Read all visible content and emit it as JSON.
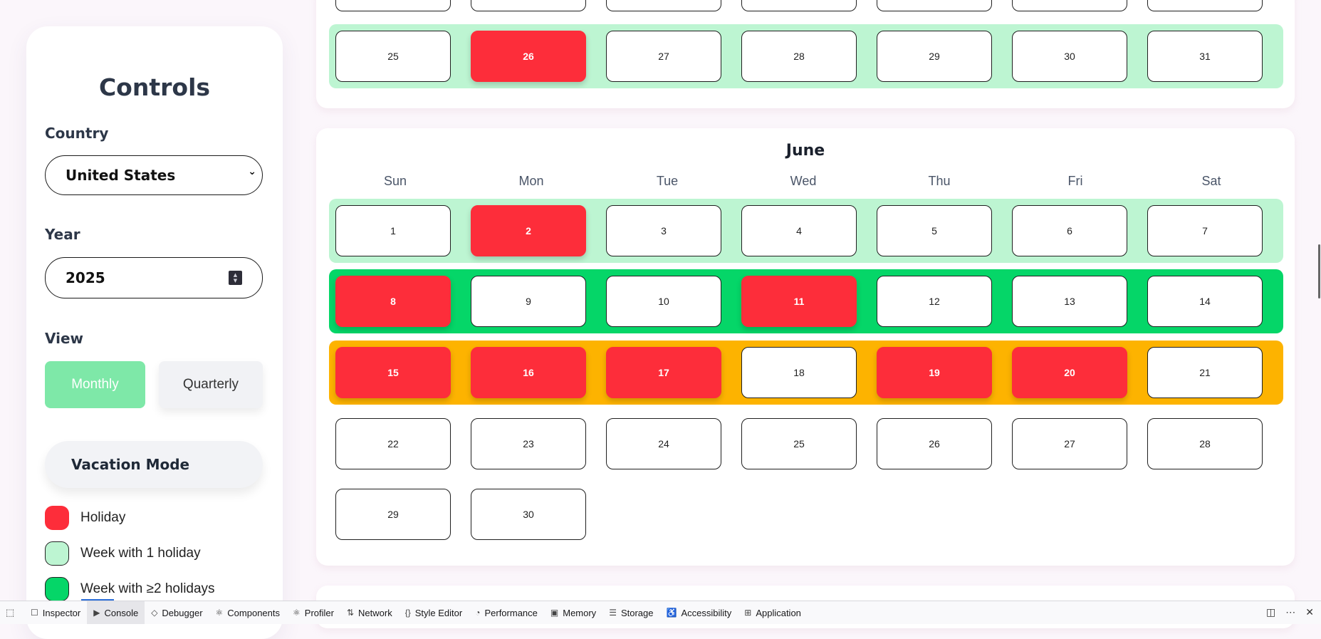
{
  "sidebar": {
    "title": "Controls",
    "country_label": "Country",
    "country_value": "United States",
    "year_label": "Year",
    "year_value": "2025",
    "view_label": "View",
    "view_monthly": "Monthly",
    "view_quarterly": "Quarterly",
    "vacation_mode": "Vacation Mode",
    "legend": [
      {
        "label": "Holiday",
        "color": "#fd2d3a"
      },
      {
        "label": "Week with 1 holiday",
        "color": "#bdf5d2"
      },
      {
        "label": "Week with ≥2 holidays",
        "color": "#05d668"
      }
    ]
  },
  "previous_month": {
    "last_week": [
      {
        "day": "25",
        "holiday": false
      },
      {
        "day": "26",
        "holiday": true
      },
      {
        "day": "27",
        "holiday": false
      },
      {
        "day": "28",
        "holiday": false
      },
      {
        "day": "29",
        "holiday": false
      },
      {
        "day": "30",
        "holiday": false
      },
      {
        "day": "31",
        "holiday": false
      }
    ]
  },
  "june": {
    "title": "June",
    "weekdays": [
      "Sun",
      "Mon",
      "Tue",
      "Wed",
      "Thu",
      "Fri",
      "Sat"
    ],
    "weeks": [
      {
        "band": "light",
        "days": [
          {
            "day": "1",
            "holiday": false
          },
          {
            "day": "2",
            "holiday": true
          },
          {
            "day": "3",
            "holiday": false
          },
          {
            "day": "4",
            "holiday": false
          },
          {
            "day": "5",
            "holiday": false
          },
          {
            "day": "6",
            "holiday": false
          },
          {
            "day": "7",
            "holiday": false
          }
        ]
      },
      {
        "band": "green",
        "days": [
          {
            "day": "8",
            "holiday": true
          },
          {
            "day": "9",
            "holiday": false
          },
          {
            "day": "10",
            "holiday": false
          },
          {
            "day": "11",
            "holiday": true
          },
          {
            "day": "12",
            "holiday": false
          },
          {
            "day": "13",
            "holiday": false
          },
          {
            "day": "14",
            "holiday": false
          }
        ]
      },
      {
        "band": "orange",
        "days": [
          {
            "day": "15",
            "holiday": true
          },
          {
            "day": "16",
            "holiday": true
          },
          {
            "day": "17",
            "holiday": true
          },
          {
            "day": "18",
            "holiday": false
          },
          {
            "day": "19",
            "holiday": true
          },
          {
            "day": "20",
            "holiday": true
          },
          {
            "day": "21",
            "holiday": false
          }
        ]
      },
      {
        "band": "none",
        "days": [
          {
            "day": "22",
            "holiday": false
          },
          {
            "day": "23",
            "holiday": false
          },
          {
            "day": "24",
            "holiday": false
          },
          {
            "day": "25",
            "holiday": false
          },
          {
            "day": "26",
            "holiday": false
          },
          {
            "day": "27",
            "holiday": false
          },
          {
            "day": "28",
            "holiday": false
          }
        ]
      },
      {
        "band": "none",
        "days": [
          {
            "day": "29",
            "holiday": false
          },
          {
            "day": "30",
            "holiday": false
          }
        ]
      }
    ]
  },
  "colors": {
    "holiday": "#fd2d3a",
    "week_one_holiday": "#bdf5d2",
    "week_multi_holiday": "#05d668",
    "week_highlight": "#fdb300",
    "monthly_active": "#7ee8a8"
  },
  "devtools": {
    "tabs": [
      {
        "label": "Inspector",
        "icon": "inspector-icon",
        "glyph": "☐"
      },
      {
        "label": "Console",
        "icon": "console-icon",
        "glyph": "▶"
      },
      {
        "label": "Debugger",
        "icon": "debugger-icon",
        "glyph": "◇"
      },
      {
        "label": "Components",
        "icon": "components-icon",
        "glyph": "⚛"
      },
      {
        "label": "Profiler",
        "icon": "profiler-icon",
        "glyph": "⚛"
      },
      {
        "label": "Network",
        "icon": "network-icon",
        "glyph": "⇅"
      },
      {
        "label": "Style Editor",
        "icon": "style-editor-icon",
        "glyph": "{}"
      },
      {
        "label": "Performance",
        "icon": "performance-icon",
        "glyph": "◔"
      },
      {
        "label": "Memory",
        "icon": "memory-icon",
        "glyph": "▣"
      },
      {
        "label": "Storage",
        "icon": "storage-icon",
        "glyph": "☰"
      },
      {
        "label": "Accessibility",
        "icon": "accessibility-icon",
        "glyph": "♿"
      },
      {
        "label": "Application",
        "icon": "application-icon",
        "glyph": "⊞"
      }
    ],
    "active_tab": "Console"
  }
}
